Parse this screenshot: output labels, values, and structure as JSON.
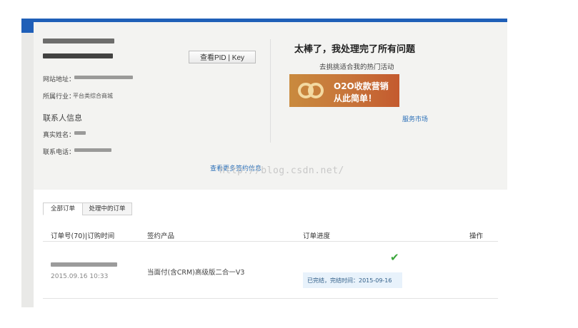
{
  "account": {
    "pid_key_button": "查看PID | Key",
    "website_label": "网站地址：",
    "industry_label": "所属行业：",
    "industry_value": "平台类综合商城",
    "contact_section_title": "联系人信息",
    "real_name_label": "真实姓名：",
    "phone_label": "联系电话：",
    "more_info_link": "查看更多签约信息"
  },
  "success_panel": {
    "title": "太棒了，我处理完了所有问题",
    "subtitle": "去挑挑适合我的热门活动",
    "banner_line1": "O2O收款营销",
    "banner_line2": "从此简单！",
    "market_link": "服务市场"
  },
  "watermark": "http://blog.csdn.net/",
  "orders": {
    "tabs": [
      "全部订单",
      "处理中的订单"
    ],
    "columns": [
      "订单号(70)|订购时间",
      "签约产品",
      "订单进度",
      "操作"
    ],
    "rows": [
      {
        "time": "2015.09.16 10:33",
        "product": "当面付(含CRM)高级版二合一V3",
        "status": "已完结，完结时间：2015-09-16"
      }
    ]
  },
  "colors": {
    "accent_blue": "#1f5fb8",
    "link": "#2a6fb8",
    "success_green": "#3aa63a"
  }
}
